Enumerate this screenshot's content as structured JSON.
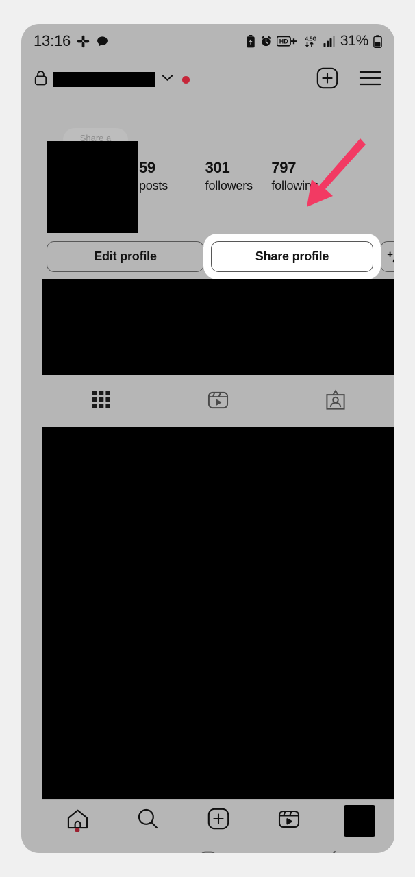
{
  "status_bar": {
    "clock": "13:16",
    "battery_percent": "31%",
    "left_icons": [
      "slack-icon",
      "chat-bubble-icon"
    ],
    "right_icons": [
      "battery-saver-icon",
      "alarm-icon",
      "hd-plus-icon",
      "network-4-5g-icon",
      "signal-bars-icon",
      "battery-icon"
    ],
    "network_label": "4.5G"
  },
  "app_header": {
    "lock_icon": "lock-icon",
    "username": "",
    "username_redacted": true,
    "chevron_icon": "chevron-down-icon",
    "unread_dot_color": "#c62639",
    "actions": [
      {
        "name": "new-post-button",
        "icon": "plus-box-icon"
      },
      {
        "name": "menu-button",
        "icon": "hamburger-menu-icon"
      }
    ]
  },
  "profile": {
    "share_note_pill_label": "Share a",
    "avatar_redacted": true,
    "stats": [
      {
        "value": "59",
        "label": "posts"
      },
      {
        "value": "301",
        "label": "followers"
      },
      {
        "value": "797",
        "label": "following"
      }
    ],
    "actions": {
      "edit_profile_label": "Edit profile",
      "share_profile_label": "Share profile",
      "share_profile_highlighted": true,
      "discover_people_icon": "add-person-icon"
    },
    "tabs": [
      {
        "name": "tab-grid",
        "icon": "grid-icon",
        "active": true
      },
      {
        "name": "tab-reels",
        "icon": "reels-icon",
        "active": false
      },
      {
        "name": "tab-tagged",
        "icon": "tagged-icon",
        "active": false
      }
    ]
  },
  "bottom_nav": [
    {
      "name": "nav-home",
      "icon": "home-icon",
      "badge_dot": true
    },
    {
      "name": "nav-search",
      "icon": "search-icon",
      "badge_dot": false
    },
    {
      "name": "nav-create",
      "icon": "plus-box-icon",
      "badge_dot": false
    },
    {
      "name": "nav-reels",
      "icon": "reels-icon",
      "badge_dot": false
    },
    {
      "name": "nav-profile",
      "icon": "avatar-icon",
      "badge_dot": false
    }
  ],
  "system_nav": {
    "recents_glyph": "|||",
    "home_icon": "square-home-icon",
    "back_icon": "chevron-left-icon"
  },
  "annotation": {
    "arrow_icon": "pointer-arrow-icon",
    "arrow_color": "#f23a63",
    "points_at": "share-profile-button"
  },
  "theme": {
    "page_background": "#f0f0f0",
    "device_background": "#b6b6b6",
    "redaction_color": "#000000",
    "highlight_color": "#ffffff",
    "text_color": "#121212"
  }
}
